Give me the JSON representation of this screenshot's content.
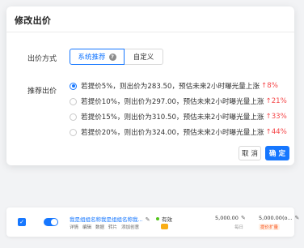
{
  "modal": {
    "title": "修改出价",
    "method_label": "出价方式",
    "method_options": [
      "系统推荐",
      "自定义"
    ],
    "help_icon": "?",
    "ratio_label": "推荐出价",
    "options": [
      {
        "text": "若提价5%，则出价为283.50，预估未来2小时曝光量上涨",
        "rise": "↑8%",
        "checked": true
      },
      {
        "text": "若提价10%，则出价为297.00，预估未来2小时曝光量上涨",
        "rise": "↑21%",
        "checked": false
      },
      {
        "text": "若提价15%，则出价为310.50，预估未来2小时曝光量上涨",
        "rise": "↑33%",
        "checked": false
      },
      {
        "text": "若提价20%，则出价为324.00，预估未来2小时曝光量上涨",
        "rise": "↑44%",
        "checked": false
      }
    ],
    "cancel_label": "取 消",
    "confirm_label": "确 定"
  },
  "row": {
    "checkbox_mark": "✓",
    "name": "我是组组名称我是组组名称我...",
    "edit_glyph": "✎",
    "actions": [
      "详情",
      "编辑",
      "数据",
      "转片",
      "添加创意"
    ],
    "status": "有效",
    "bid": "5,000.00",
    "bid_sub": "每日",
    "budget": "5,000.00(o...",
    "budget_tag": "提价扩量"
  },
  "colors": {
    "primary": "#1677ff",
    "rise": "#f5484a",
    "status_ok": "#52c41a",
    "warn": "#faad14"
  }
}
